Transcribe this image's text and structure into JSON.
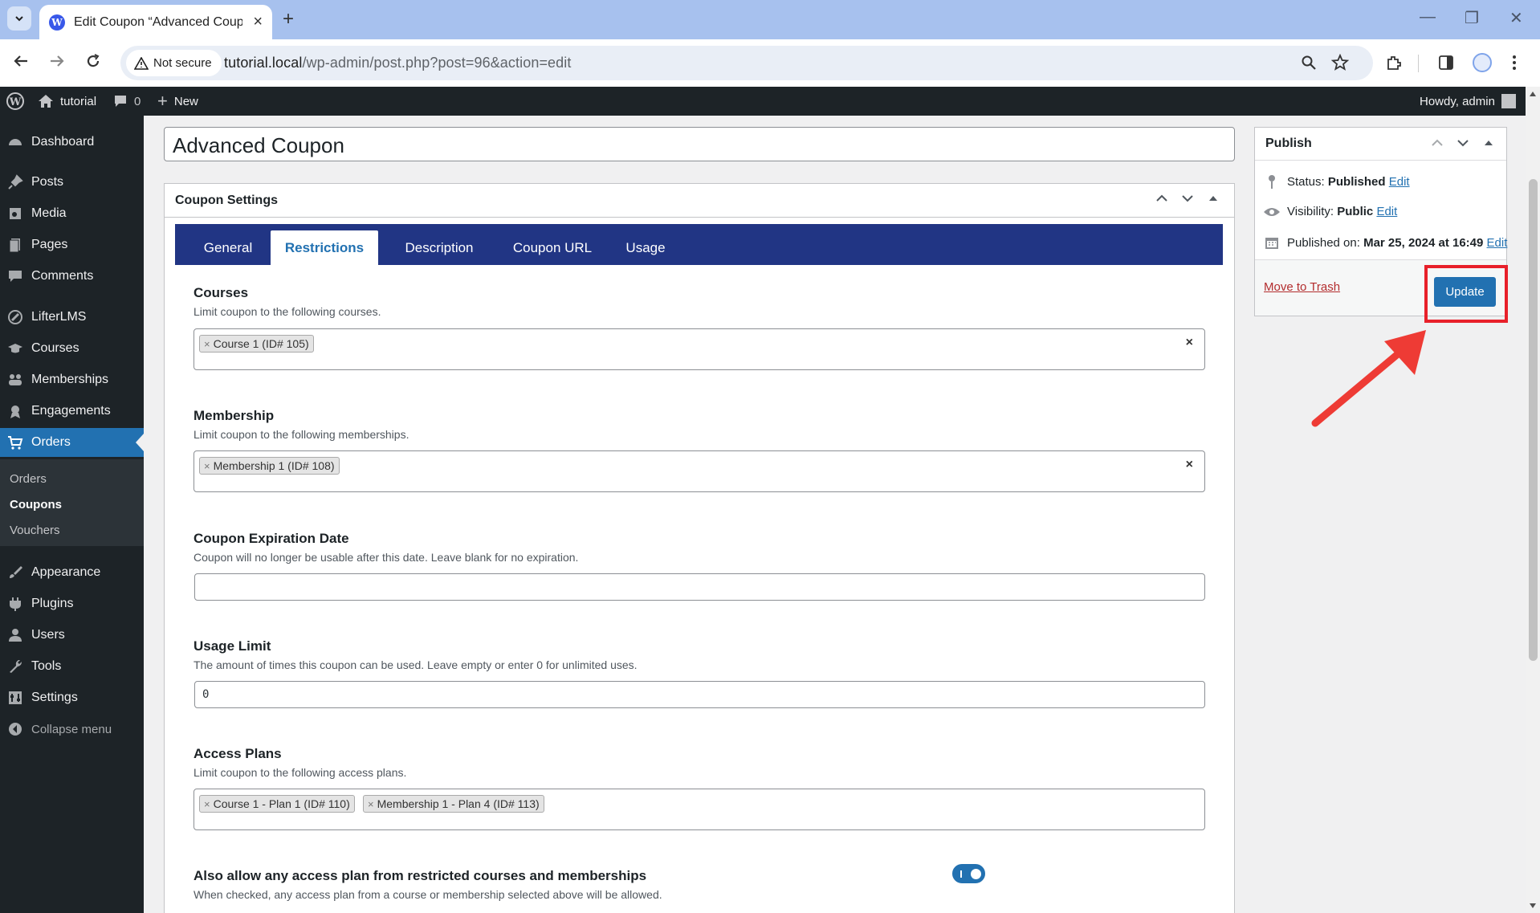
{
  "browser": {
    "tab_title": "Edit Coupon “Advanced Coupon”",
    "not_secure": "Not secure",
    "url_host": "tutorial.local",
    "url_path": "/wp-admin/post.php?post=96&action=edit"
  },
  "adminbar": {
    "site_name": "tutorial",
    "comments_count": "0",
    "new_label": "New",
    "howdy": "Howdy, admin"
  },
  "sidebar": {
    "items": [
      {
        "label": "Dashboard",
        "icon": "dashboard-icon"
      },
      {
        "label": "Posts",
        "icon": "pin-icon"
      },
      {
        "label": "Media",
        "icon": "media-icon"
      },
      {
        "label": "Pages",
        "icon": "pages-icon"
      },
      {
        "label": "Comments",
        "icon": "comment-icon"
      },
      {
        "label": "LifterLMS",
        "icon": "lifterlms-icon"
      },
      {
        "label": "Courses",
        "icon": "graduation-cap-icon"
      },
      {
        "label": "Memberships",
        "icon": "groups-icon"
      },
      {
        "label": "Engagements",
        "icon": "award-icon"
      },
      {
        "label": "Orders",
        "icon": "cart-icon"
      },
      {
        "label": "Appearance",
        "icon": "brush-icon"
      },
      {
        "label": "Plugins",
        "icon": "plug-icon"
      },
      {
        "label": "Users",
        "icon": "user-icon"
      },
      {
        "label": "Tools",
        "icon": "wrench-icon"
      },
      {
        "label": "Settings",
        "icon": "settings-icon"
      },
      {
        "label": "Collapse menu",
        "icon": "collapse-icon"
      }
    ],
    "submenu": [
      "Orders",
      "Coupons",
      "Vouchers"
    ]
  },
  "post": {
    "title": "Advanced Coupon"
  },
  "coupon_settings": {
    "heading": "Coupon Settings",
    "tabs": [
      "General",
      "Restrictions",
      "Description",
      "Coupon URL",
      "Usage"
    ],
    "active_tab": "Restrictions",
    "courses": {
      "label": "Courses",
      "desc": "Limit coupon to the following courses.",
      "chips": [
        "Course 1 (ID# 105)"
      ]
    },
    "membership": {
      "label": "Membership",
      "desc": "Limit coupon to the following memberships.",
      "chips": [
        "Membership 1 (ID# 108)"
      ]
    },
    "expiration": {
      "label": "Coupon Expiration Date",
      "desc": "Coupon will no longer be usable after this date. Leave blank for no expiration.",
      "value": ""
    },
    "usage_limit": {
      "label": "Usage Limit",
      "desc": "The amount of times this coupon can be used. Leave empty or enter 0 for unlimited uses.",
      "value": "0"
    },
    "access_plans": {
      "label": "Access Plans",
      "desc": "Limit coupon to the following access plans.",
      "chips": [
        "Course 1 - Plan 1 (ID# 110)",
        "Membership 1 - Plan 4 (ID# 113)"
      ]
    },
    "allow_any": {
      "label": "Also allow any access plan from restricted courses and memberships",
      "desc": "When checked, any access plan from a course or membership selected above will be allowed.",
      "checked": true
    }
  },
  "publish": {
    "heading": "Publish",
    "status_label": "Status:",
    "status_value": "Published",
    "visibility_label": "Visibility:",
    "visibility_value": "Public",
    "published_label": "Published on:",
    "published_value": "Mar 25, 2024 at 16:49",
    "edit": "Edit",
    "trash": "Move to Trash",
    "update": "Update"
  },
  "colors": {
    "accent": "#2271b1",
    "tabs_bg": "#213584",
    "admin_dark": "#1d2327",
    "highlight": "#e8202a"
  }
}
